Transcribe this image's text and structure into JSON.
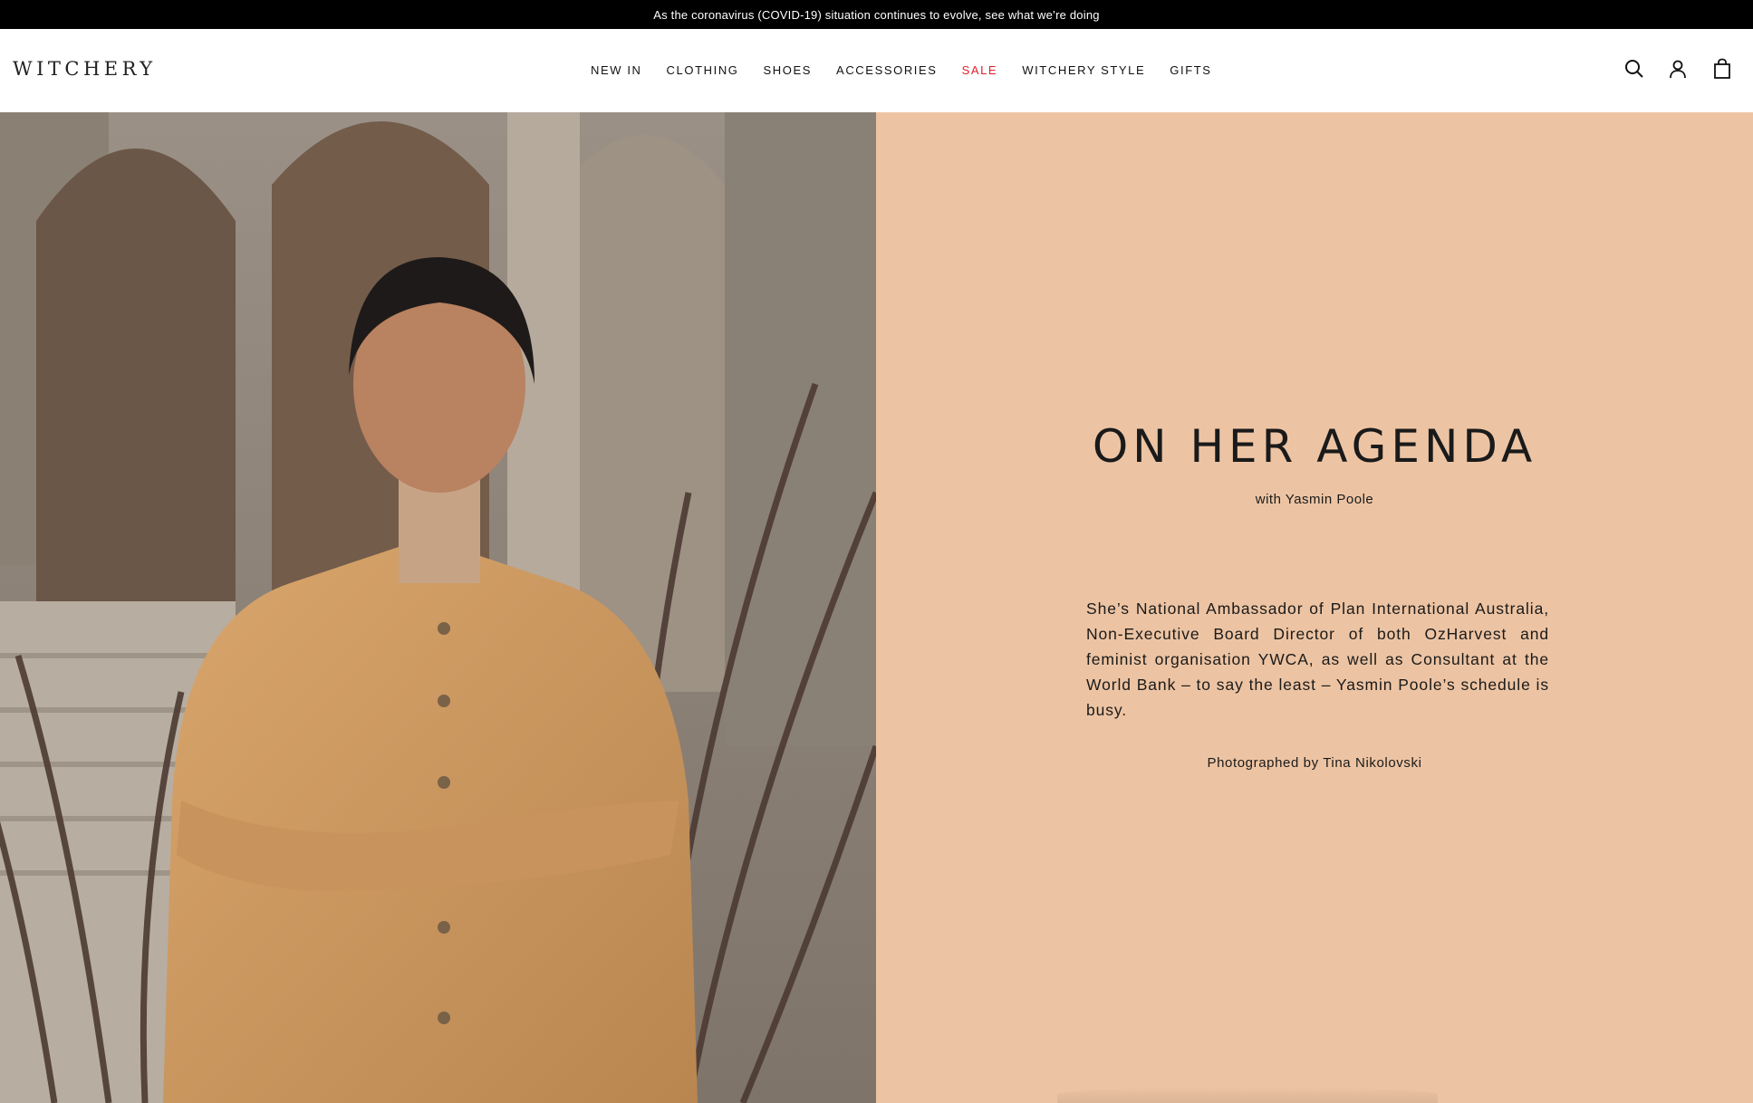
{
  "announcement": {
    "text": "As the coronavirus (COVID-19) situation continues to evolve, see what we’re doing"
  },
  "header": {
    "logo": "WITCHERY",
    "nav": [
      {
        "label": "NEW IN"
      },
      {
        "label": "CLOTHING"
      },
      {
        "label": "SHOES"
      },
      {
        "label": "ACCESSORIES"
      },
      {
        "label": "SALE",
        "color": "#e0202a"
      },
      {
        "label": "WITCHERY STYLE"
      },
      {
        "label": "GIFTS"
      }
    ],
    "icons": [
      "search-icon",
      "account-icon",
      "bag-icon"
    ]
  },
  "hero": {
    "image_alt": "Woman in tan utility shirt dress with crossed arms in front of arches and plants",
    "title": "ON HER AGENDA",
    "subtitle": "with Yasmin Poole",
    "body": "She’s National Ambassador of Plan International Australia, Non-Executive Board Director of both OzHarvest and feminist organisation YWCA, as well as Consultant at the World Bank – to say the least – Yasmin Poole’s schedule is busy.",
    "credit": "Photographed by Tina Nikolovski",
    "panel_color": "#edc4a3"
  }
}
